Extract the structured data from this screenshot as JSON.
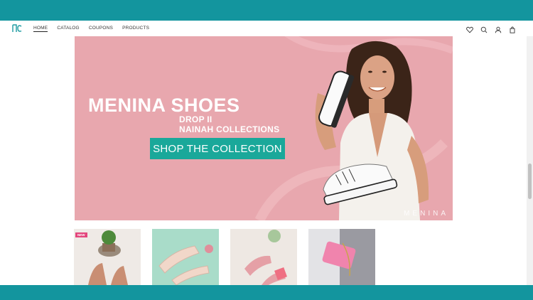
{
  "header": {
    "nav": [
      {
        "label": "HOME"
      },
      {
        "label": "CATALOG"
      },
      {
        "label": "COUPONS"
      },
      {
        "label": "PRODUCTS"
      }
    ],
    "icons": [
      "heart-icon",
      "search-icon",
      "user-icon",
      "bag-icon"
    ]
  },
  "hero": {
    "title": "MENINA SHOES",
    "subtitle_line1": "DROP II",
    "subtitle_line2": "NAINAH COLLECTIONS",
    "cta_label": "SHOP THE COLLECTION",
    "watermark": "MENINA",
    "colors": {
      "background": "#e8a7ae",
      "cta": "#1aa89a"
    }
  },
  "products": [
    {
      "badge": "NEW"
    },
    {},
    {},
    {}
  ],
  "colors": {
    "frame": "#13959e"
  }
}
